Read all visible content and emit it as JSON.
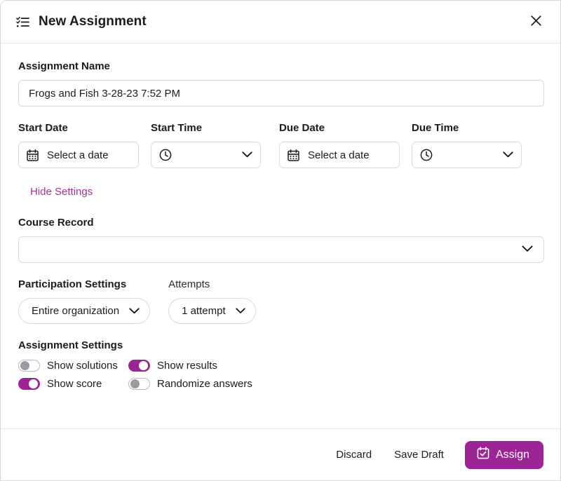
{
  "header": {
    "title": "New Assignment",
    "icon": "checklist-icon",
    "close_icon": "close-icon"
  },
  "form": {
    "assignment_name": {
      "label": "Assignment Name",
      "value": "Frogs and Fish 3-28-23 7:52 PM",
      "placeholder": ""
    },
    "start_date": {
      "label": "Start Date",
      "value": "Select a date",
      "icon": "calendar-icon"
    },
    "start_time": {
      "label": "Start Time",
      "value": "",
      "icon": "clock-icon"
    },
    "due_date": {
      "label": "Due Date",
      "value": "Select a date",
      "icon": "calendar-icon"
    },
    "due_time": {
      "label": "Due Time",
      "value": "",
      "icon": "clock-icon"
    },
    "hide_settings_label": "Hide Settings",
    "course_record": {
      "label": "Course Record",
      "value": ""
    },
    "participation_settings": {
      "label": "Participation Settings",
      "value": "Entire organization"
    },
    "attempts": {
      "label": "Attempts",
      "value": "1 attempt"
    },
    "assignment_settings": {
      "label": "Assignment Settings",
      "toggles": [
        {
          "label": "Show solutions",
          "state": "off"
        },
        {
          "label": "Show results",
          "state": "on"
        },
        {
          "label": "Show score",
          "state": "on"
        },
        {
          "label": "Randomize answers",
          "state": "off"
        }
      ]
    }
  },
  "footer": {
    "discard_label": "Discard",
    "save_draft_label": "Save Draft",
    "assign_label": "Assign",
    "assign_icon": "calendar-check-icon"
  },
  "colors": {
    "accent": "#9c2596",
    "link": "#a3329a",
    "text": "#1b1b1f",
    "border": "#d9d9dd"
  }
}
